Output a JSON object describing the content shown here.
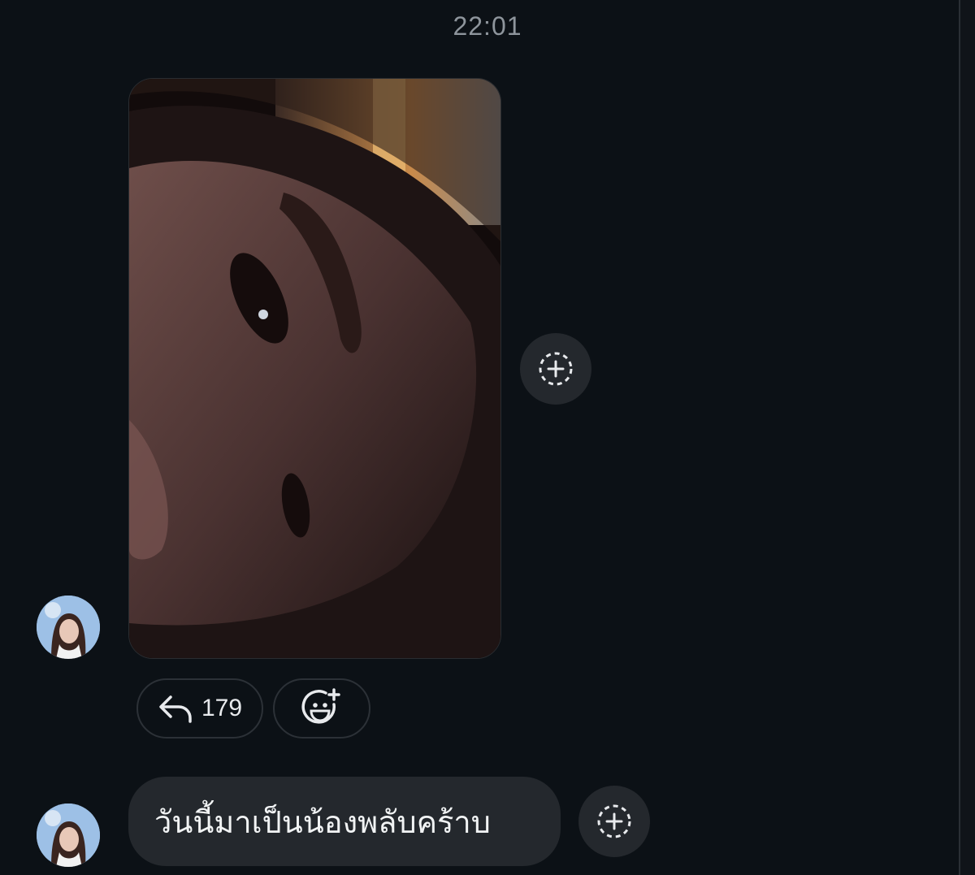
{
  "conversation": {
    "timestamp": "22:01"
  },
  "messages": [
    {
      "type": "image",
      "reactions": {
        "reply_count": "179",
        "reply_icon": "reply-arrow-icon",
        "emoji_icon": "add-emoji-icon"
      },
      "add_reaction_icon": "add-reaction-icon"
    },
    {
      "type": "text",
      "text": "วันนี้มาเป็นน้องพลับคร้าบ",
      "add_reaction_icon": "add-reaction-icon"
    }
  ],
  "colors": {
    "background": "#0c1116",
    "bubble": "#24282d",
    "timestamp": "#8e959c",
    "text": "#f1f3f4"
  }
}
